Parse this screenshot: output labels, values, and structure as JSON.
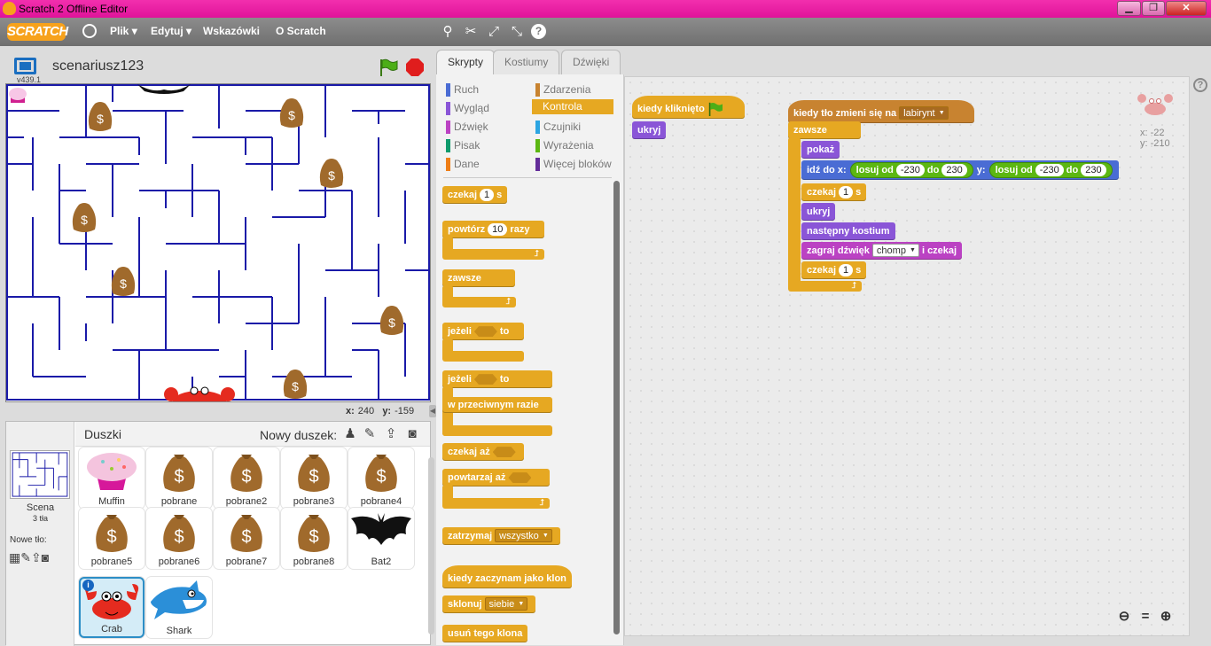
{
  "window": {
    "title": "Scratch 2 Offline Editor",
    "buttons": [
      "▁",
      "❐",
      "✕"
    ]
  },
  "menubar": {
    "logo": "SCRATCH",
    "file": "Plik",
    "edit": "Edytuj",
    "tips": "Wskazówki",
    "about": "O Scratch",
    "tools": [
      "stamp-tool",
      "cut-tool",
      "grow-tool",
      "shrink-tool",
      "help-tool"
    ]
  },
  "stage_header": {
    "project_name": "scenariusz123",
    "version": "v439.1"
  },
  "stage_coords": {
    "x_label": "x:",
    "x_value": "240",
    "y_label": "y:",
    "y_value": "-159"
  },
  "sprites_panel": {
    "title": "Duszki",
    "new_sprite_label": "Nowy duszek:",
    "scene_label": "Scena",
    "scene_backdrops": "3 tła",
    "new_backdrop_label": "Nowe tło:",
    "sprites": [
      {
        "name": "Muffin",
        "icon": "muffin"
      },
      {
        "name": "pobrane",
        "icon": "money-bag"
      },
      {
        "name": "pobrane2",
        "icon": "money-bag"
      },
      {
        "name": "pobrane3",
        "icon": "money-bag"
      },
      {
        "name": "pobrane4",
        "icon": "money-bag"
      },
      {
        "name": "pobrane5",
        "icon": "money-bag"
      },
      {
        "name": "pobrane6",
        "icon": "money-bag"
      },
      {
        "name": "pobrane7",
        "icon": "money-bag"
      },
      {
        "name": "pobrane8",
        "icon": "money-bag"
      },
      {
        "name": "Bat2",
        "icon": "bat"
      },
      {
        "name": "Crab",
        "icon": "crab",
        "selected": true
      },
      {
        "name": "Shark",
        "icon": "shark"
      }
    ]
  },
  "tabs": [
    "Skrypty",
    "Kostiumy",
    "Dźwięki"
  ],
  "categories": [
    {
      "name": "Ruch",
      "color": "#4a6cd4"
    },
    {
      "name": "Zdarzenia",
      "color": "#c88330"
    },
    {
      "name": "Wygląd",
      "color": "#8a55d7"
    },
    {
      "name": "Kontrola",
      "color": "#e6a822",
      "selected": true
    },
    {
      "name": "Dźwięk",
      "color": "#bb42c3"
    },
    {
      "name": "Czujniki",
      "color": "#2ca5e2"
    },
    {
      "name": "Pisak",
      "color": "#0e9a6c"
    },
    {
      "name": "Wyrażenia",
      "color": "#5cb712"
    },
    {
      "name": "Dane",
      "color": "#ee7d16"
    },
    {
      "name": "Więcej bloków",
      "color": "#632d99"
    }
  ],
  "palette": {
    "wait": "czekaj",
    "wait_val": "1",
    "wait_unit": "s",
    "repeat": "powtórz",
    "repeat_val": "10",
    "repeat_unit": "razy",
    "forever": "zawsze",
    "if": "jeżeli",
    "then": "to",
    "if2": "jeżeli",
    "then2": "to",
    "else": "w przeciwnym razie",
    "wait_until": "czekaj aż",
    "repeat_until": "powtarzaj aż",
    "stop": "zatrzymaj",
    "stop_opt": "wszystko",
    "clone_start": "kiedy zaczynam jako klon",
    "clone": "sklonuj",
    "clone_opt": "siebie",
    "delete_clone": "usuń tego klona"
  },
  "scripts": {
    "s1_hat": "kiedy kliknięto",
    "s1_hide": "ukryj",
    "s2_hat": "kiedy tło zmieni się na",
    "s2_hat_opt": "labirynt",
    "forever": "zawsze",
    "show": "pokaż",
    "goto": "idź do x:",
    "rand1": "losuj od",
    "rand1_from": "-230",
    "rand1_to_lbl": "do",
    "rand1_to": "230",
    "y_lbl": "y:",
    "rand2": "losuj od",
    "rand2_from": "-230",
    "rand2_to_lbl": "do",
    "rand2_to": "230",
    "wait1": "czekaj",
    "wait1_val": "1",
    "wait1_unit": "s",
    "hide": "ukryj",
    "next_costume": "następny kostium",
    "play_sound": "zagraj dźwięk",
    "sound_opt": "chomp",
    "play_sound_end": "i czekaj",
    "wait2": "czekaj",
    "wait2_val": "1",
    "wait2_unit": "s"
  },
  "sprite_info": {
    "x_label": "x:",
    "x": "-22",
    "y_label": "y:",
    "y": "-210"
  },
  "zoom": {
    "out": "🔍-",
    "reset": "=",
    "in": "🔍+"
  }
}
